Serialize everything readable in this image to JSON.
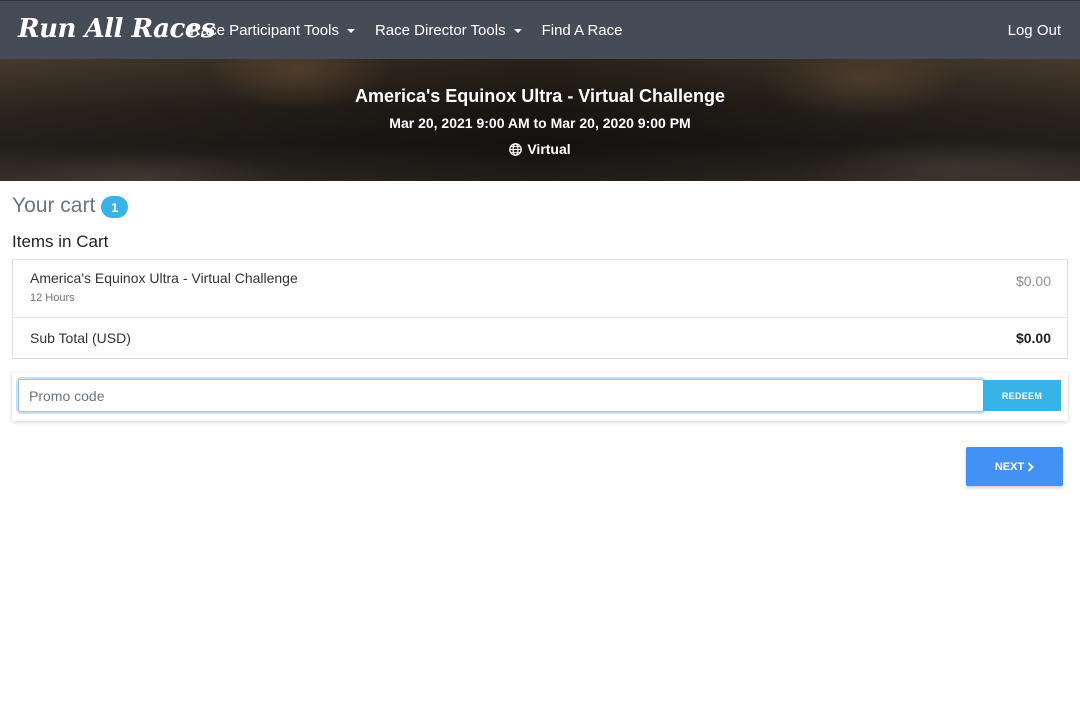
{
  "navbar": {
    "brand": "Run All Races",
    "items": [
      {
        "label": "Race Participant Tools",
        "dropdown": true
      },
      {
        "label": "Race Director Tools",
        "dropdown": true
      },
      {
        "label": "Find A Race",
        "dropdown": false
      }
    ],
    "logout": "Log Out",
    "background": "#454c57"
  },
  "hero": {
    "title": "America's Equinox Ultra - Virtual Challenge",
    "dates": "Mar 20, 2021 9:00 AM to Mar 20, 2020 9:00 PM",
    "location_icon": "globe-icon",
    "location": "Virtual"
  },
  "cart": {
    "title": "Your cart",
    "count": "1",
    "items_heading": "Items in Cart",
    "items": [
      {
        "name": "America's Equinox Ultra - Virtual Challenge",
        "detail": "12 Hours",
        "price": "$0.00"
      }
    ],
    "subtotal_label": "Sub Total (USD)",
    "subtotal_value": "$0.00"
  },
  "promo": {
    "placeholder": "Promo code",
    "value": "",
    "button": "REDEEM"
  },
  "actions": {
    "next": "NEXT",
    "next_icon": "chevron-right-icon"
  },
  "colors": {
    "accent": "#38b3e8",
    "primary": "#4192f4"
  }
}
